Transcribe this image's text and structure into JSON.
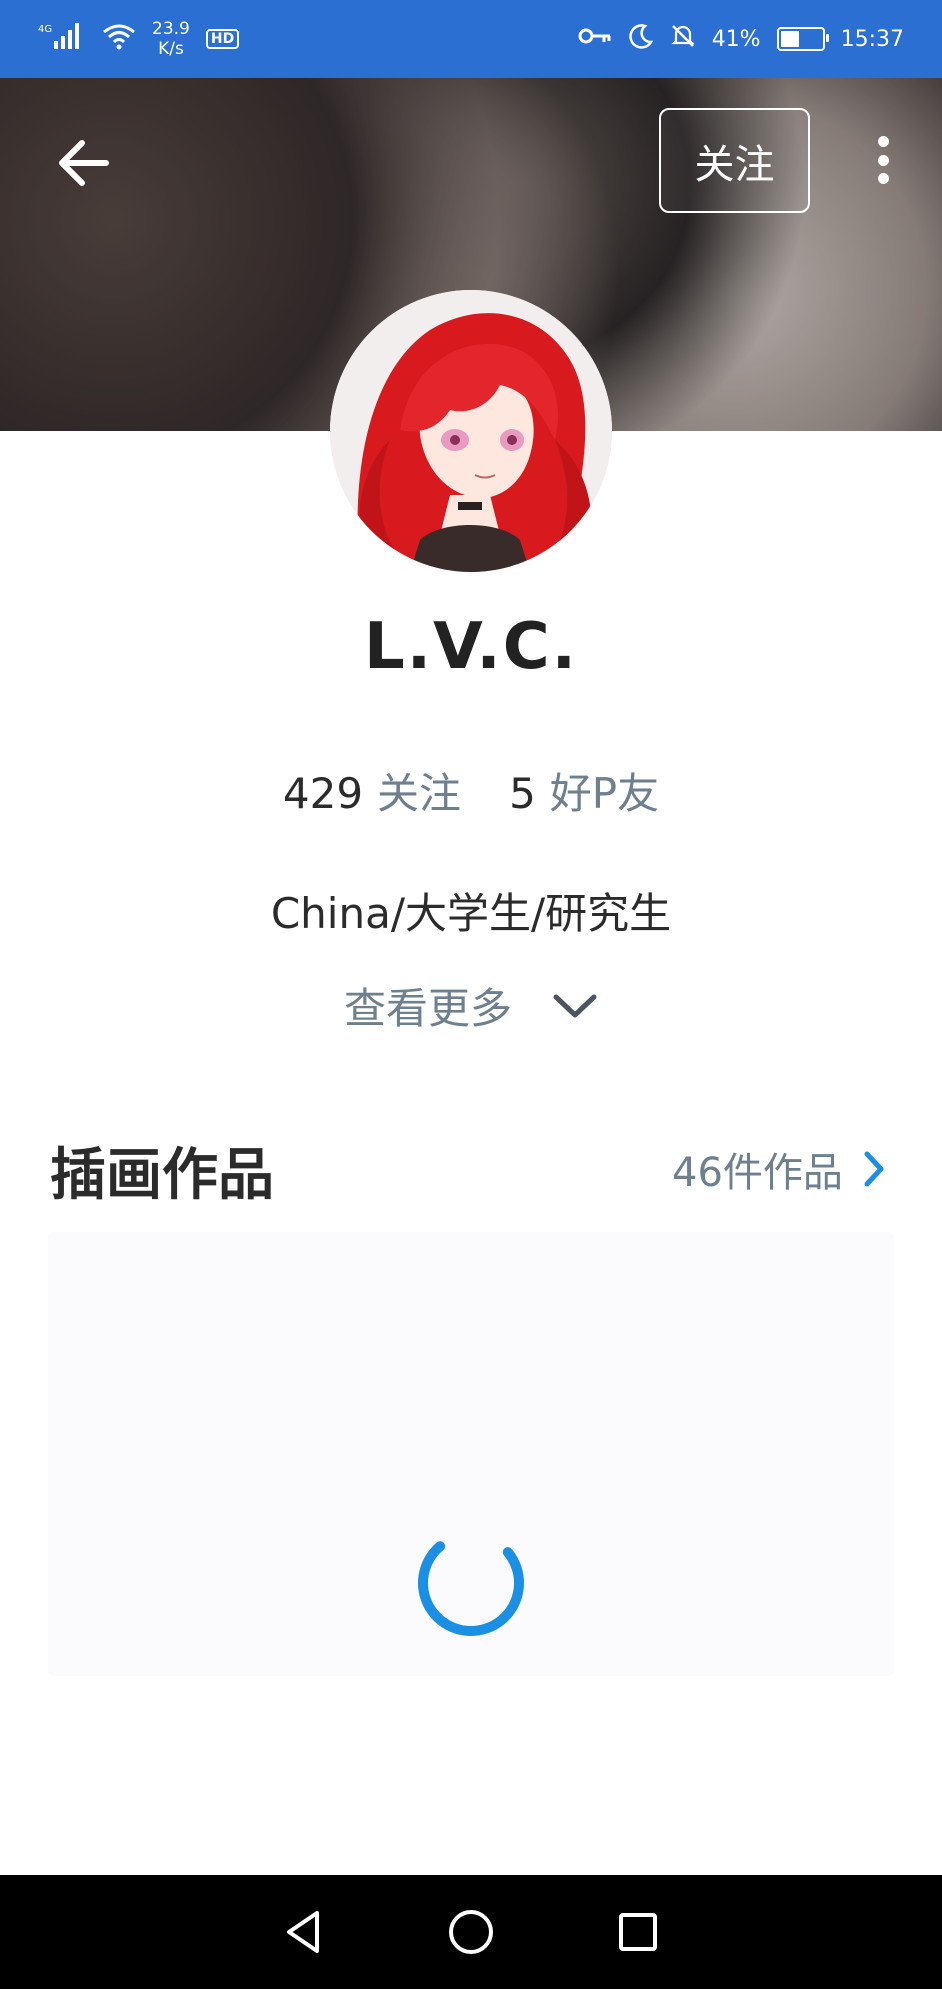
{
  "status_bar": {
    "network": "4G",
    "speed_value": "23.9",
    "speed_unit": "K/s",
    "hd_label": "HD",
    "battery": "41%",
    "battery_level": 0.41,
    "time": "15:37"
  },
  "header": {
    "follow_label": "关注"
  },
  "profile": {
    "username": "L.V.C.",
    "following_count": "429",
    "following_label": "关注",
    "friends_count": "5",
    "friends_label": "好P友",
    "bio": "China/大学生/研究生",
    "see_more_label": "查看更多"
  },
  "illustrations": {
    "title": "插画作品",
    "count_label": "46件作品"
  },
  "colors": {
    "status_bar_bg": "#2a6fd1",
    "accent": "#1a8fe3",
    "secondary_text": "#6e7f8e",
    "panel_bg": "#fbfafd"
  },
  "icons": {
    "back": "arrow-left-icon",
    "more": "more-vertical-icon",
    "see_more": "chevron-down-icon",
    "works": "chevron-right-icon",
    "loading": "spinner-icon",
    "nav_back": "triangle-back-icon",
    "nav_home": "circle-home-icon",
    "nav_recent": "square-recents-icon"
  }
}
